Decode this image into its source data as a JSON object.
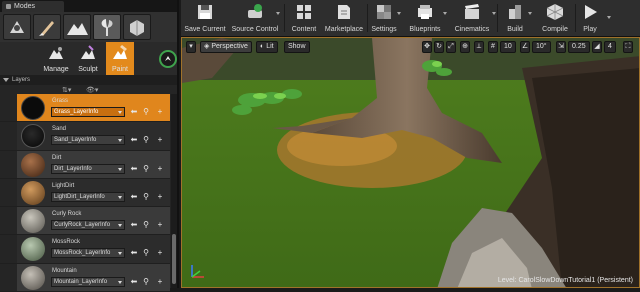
{
  "modes_panel": {
    "tab_title": "Modes",
    "tools": [
      {
        "label": "Manage"
      },
      {
        "label": "Sculpt"
      },
      {
        "label": "Paint"
      }
    ],
    "layers_header": "Layers",
    "layers": [
      {
        "name": "Grass",
        "info": "Grass_LayerInfo",
        "color": "#3c8a1a",
        "selected": true
      },
      {
        "name": "Sand",
        "info": "Sand_LayerInfo",
        "color": "#3a3a3a",
        "selected": false
      },
      {
        "name": "Dirt",
        "info": "Dirt_LayerInfo",
        "color": "#7a4a2a",
        "selected": false
      },
      {
        "name": "LightDirt",
        "info": "LightDirt_LayerInfo",
        "color": "#9a6a3c",
        "selected": false
      },
      {
        "name": "Curly Rock",
        "info": "CurlyRock_LayerInfo",
        "color": "#8c8c86",
        "selected": false
      },
      {
        "name": "MossRock",
        "info": "MossRock_LayerInfo",
        "color": "#6e8468",
        "selected": false
      },
      {
        "name": "Mountain",
        "info": "Mountain_LayerInfo",
        "color": "#8a8680",
        "selected": false
      }
    ]
  },
  "toolbar": {
    "buttons": [
      {
        "label": "Save Current",
        "icon": "save-icon"
      },
      {
        "label": "Source Control",
        "icon": "source-control-icon"
      },
      {
        "label": "Content",
        "icon": "content-icon"
      },
      {
        "label": "Marketplace",
        "icon": "marketplace-icon"
      },
      {
        "label": "Settings",
        "icon": "settings-icon"
      },
      {
        "label": "Blueprints",
        "icon": "blueprints-icon"
      },
      {
        "label": "Cinematics",
        "icon": "cinematics-icon"
      },
      {
        "label": "Build",
        "icon": "build-icon"
      },
      {
        "label": "Compile",
        "icon": "compile-icon"
      },
      {
        "label": "Play",
        "icon": "play-icon"
      }
    ]
  },
  "viewport": {
    "perspective_label": "Perspective",
    "lit_label": "Lit",
    "show_label": "Show",
    "grid_snap": "10",
    "rotation_snap": "10°",
    "scale_snap": "0.25",
    "camera_speed": "4",
    "level_prefix": "Level:",
    "level_name": "CarolSlowDownTutorial1 (Persistent)"
  },
  "colors": {
    "accent": "#e38a1c",
    "panel": "#242424",
    "pin_ring": "#3fa34d"
  }
}
